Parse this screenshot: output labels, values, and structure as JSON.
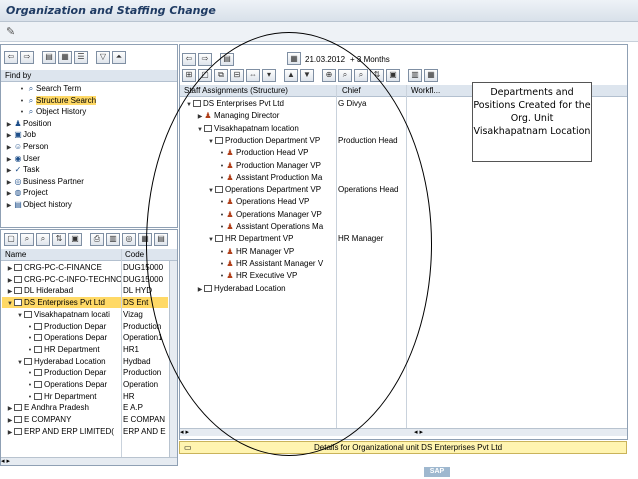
{
  "window": {
    "title": "Organization and Staffing Change"
  },
  "find_by": {
    "label": "Find by",
    "items": [
      {
        "label": "Search Term",
        "level": 1,
        "expanded": false,
        "icon": "binoculars-icon",
        "selected": false
      },
      {
        "label": "Structure Search",
        "level": 1,
        "expanded": false,
        "icon": "binoculars-icon",
        "selected": true
      },
      {
        "label": "Object History",
        "level": 1,
        "expanded": false,
        "icon": "binoculars-icon",
        "selected": false
      },
      {
        "label": "Position",
        "level": 0,
        "expanded": false,
        "icon": "person-icon",
        "selected": false
      },
      {
        "label": "Job",
        "level": 0,
        "expanded": false,
        "icon": "job-icon",
        "selected": false
      },
      {
        "label": "Person",
        "level": 0,
        "expanded": false,
        "icon": "people-icon",
        "selected": false
      },
      {
        "label": "User",
        "level": 0,
        "expanded": false,
        "icon": "user-icon",
        "selected": false
      },
      {
        "label": "Task",
        "level": 0,
        "expanded": false,
        "icon": "task-icon",
        "selected": false
      },
      {
        "label": "Business Partner",
        "level": 0,
        "expanded": false,
        "icon": "partner-icon",
        "selected": false
      },
      {
        "label": "Project",
        "level": 0,
        "expanded": false,
        "icon": "project-icon",
        "selected": false
      },
      {
        "label": "Object history",
        "level": 0,
        "expanded": false,
        "icon": "history-icon",
        "selected": false
      }
    ]
  },
  "hit_list": {
    "columns": [
      "Name",
      "Code"
    ],
    "rows": [
      {
        "name": "CRG-PC-C-FINANCE",
        "code": "DUG15000",
        "level": 0,
        "expanded": false,
        "selected": false
      },
      {
        "name": "CRG-PC-C-INFO-TECHNO",
        "code": "DUG15000",
        "level": 0,
        "expanded": false,
        "selected": false
      },
      {
        "name": "DL Hiderabad",
        "code": "DL HYD",
        "level": 0,
        "expanded": false,
        "selected": false
      },
      {
        "name": "DS Enterprises Pvt Ltd",
        "code": "DS Ent",
        "level": 0,
        "expanded": true,
        "selected": true
      },
      {
        "name": "Visakhapatnam locati",
        "code": "Vizag",
        "level": 1,
        "expanded": true,
        "selected": false
      },
      {
        "name": "Production Depar",
        "code": "Production",
        "level": 2,
        "expanded": false,
        "selected": false
      },
      {
        "name": "Operations Depar",
        "code": "Operation1",
        "level": 2,
        "expanded": false,
        "selected": false
      },
      {
        "name": "HR Department",
        "code": "HR1",
        "level": 2,
        "expanded": false,
        "selected": false
      },
      {
        "name": "Hyderabad Location",
        "code": "Hydbad",
        "level": 1,
        "expanded": true,
        "selected": false
      },
      {
        "name": "Production Depar",
        "code": "Production",
        "level": 2,
        "expanded": false,
        "selected": false
      },
      {
        "name": "Operations Depar",
        "code": "Operation",
        "level": 2,
        "expanded": false,
        "selected": false
      },
      {
        "name": "Hr Department",
        "code": "HR",
        "level": 2,
        "expanded": false,
        "selected": false
      },
      {
        "name": "E Andhra Pradesh",
        "code": "E A.P",
        "level": 0,
        "expanded": false,
        "selected": false
      },
      {
        "name": "E COMPANY",
        "code": "E COMPAN",
        "level": 0,
        "expanded": false,
        "selected": false
      },
      {
        "name": "ERP AND ERP LIMITED(",
        "code": "ERP AND E",
        "level": 0,
        "expanded": false,
        "selected": false
      }
    ]
  },
  "overview": {
    "date": "21.03.2012",
    "period": "+ 3 Months",
    "columns": [
      "Staff Assignments (Structure)",
      "Chief",
      "Workfl..."
    ],
    "rows": [
      {
        "label": "DS Enterprises Pvt Ltd",
        "chief": "G Divya",
        "level": 0,
        "node": "expanded",
        "type": "org"
      },
      {
        "label": "Managing Director",
        "chief": "",
        "level": 1,
        "node": "collapsed",
        "type": "position"
      },
      {
        "label": "Visakhapatnam location",
        "chief": "",
        "level": 1,
        "node": "expanded",
        "type": "org"
      },
      {
        "label": "Production Department VP",
        "chief": "Production Head",
        "level": 2,
        "node": "expanded",
        "type": "org"
      },
      {
        "label": "Production Head VP",
        "chief": "",
        "level": 3,
        "node": "leaf",
        "type": "position"
      },
      {
        "label": "Production Manager VP",
        "chief": "",
        "level": 3,
        "node": "leaf",
        "type": "position"
      },
      {
        "label": "Assistant Production Ma",
        "chief": "",
        "level": 3,
        "node": "leaf",
        "type": "position"
      },
      {
        "label": "Operations Department VP",
        "chief": "Operations Head",
        "level": 2,
        "node": "expanded",
        "type": "org"
      },
      {
        "label": "Operations Head VP",
        "chief": "",
        "level": 3,
        "node": "leaf",
        "type": "position"
      },
      {
        "label": "Operations Manager VP",
        "chief": "",
        "level": 3,
        "node": "leaf",
        "type": "position"
      },
      {
        "label": "Assistant Operations Ma",
        "chief": "",
        "level": 3,
        "node": "leaf",
        "type": "position"
      },
      {
        "label": "HR Department VP",
        "chief": "HR Manager",
        "level": 2,
        "node": "expanded",
        "type": "org"
      },
      {
        "label": "HR Manager VP",
        "chief": "",
        "level": 3,
        "node": "leaf",
        "type": "position"
      },
      {
        "label": "HR Assistant Manager V",
        "chief": "",
        "level": 3,
        "node": "leaf",
        "type": "position"
      },
      {
        "label": "HR Executive VP",
        "chief": "",
        "level": 3,
        "node": "leaf",
        "type": "position"
      },
      {
        "label": "Hyderabad Location",
        "chief": "",
        "level": 1,
        "node": "collapsed",
        "type": "org"
      }
    ]
  },
  "status": {
    "text": "Details for Organizational unit DS Enterprises Pvt Ltd"
  },
  "callout": {
    "text": "Departments and Positions Created for the Org. Unit Visakhapatnam Location"
  },
  "footer": {
    "logo": "SAP"
  },
  "colors": {
    "selection": "#ffd966",
    "header": "#dde5ee",
    "title": "#1f3b63",
    "status_bg": "#fff4b0"
  }
}
